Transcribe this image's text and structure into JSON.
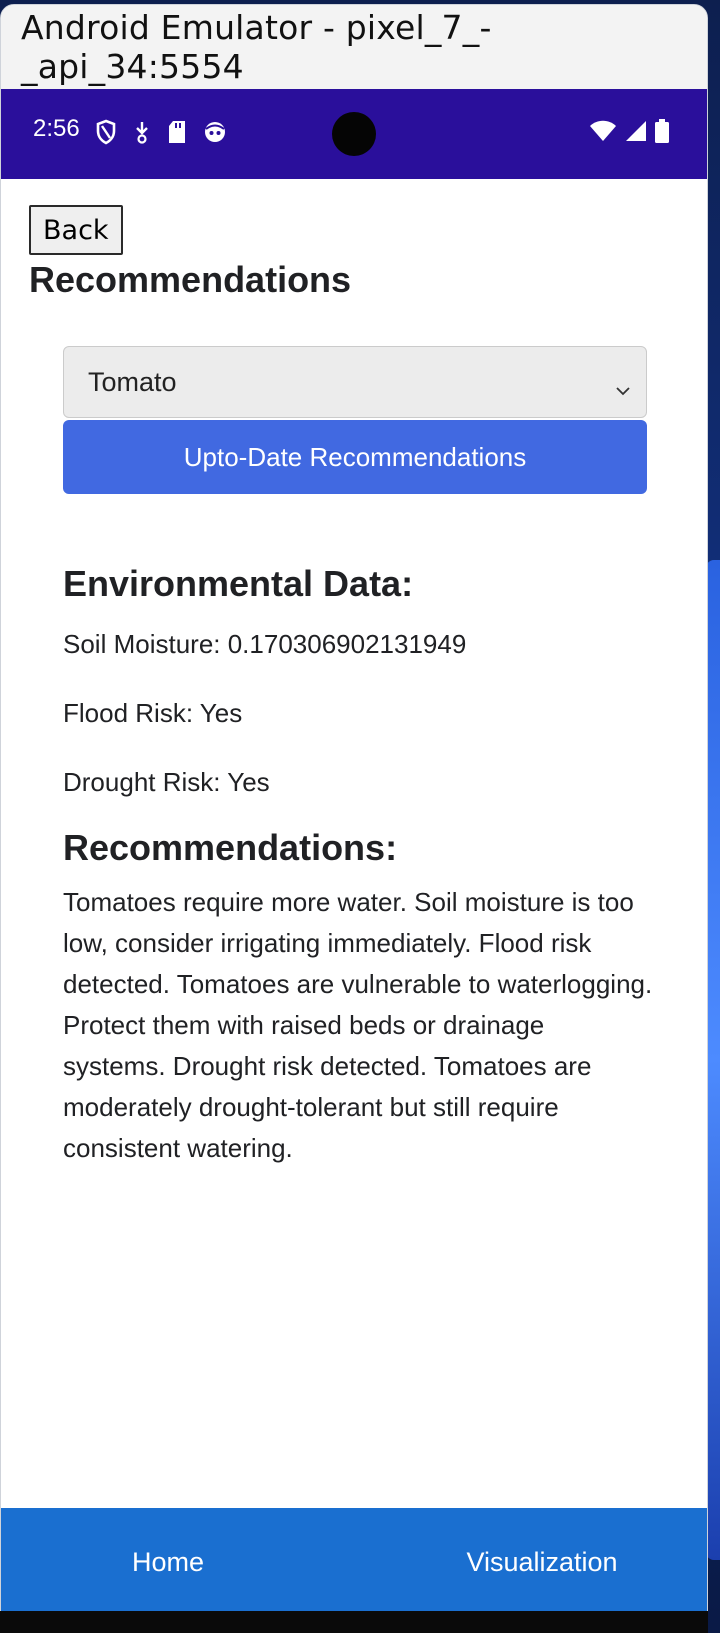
{
  "window": {
    "title": "Android Emulator - pixel_7_-_api_34:5554"
  },
  "status_bar": {
    "time": "2:56",
    "left_icons": [
      "shield-icon",
      "download-icon",
      "sd-card-icon",
      "face-icon"
    ],
    "right_icons": [
      "wifi-icon",
      "signal-icon",
      "battery-icon"
    ]
  },
  "page": {
    "back_label": "Back",
    "title": "Recommendations",
    "crop_select": {
      "value": "Tomato"
    },
    "update_button_label": "Upto-Date Recommendations"
  },
  "environment": {
    "heading": "Environmental Data:",
    "soil_moisture": "Soil Moisture: 0.170306902131949",
    "flood_risk": "Flood Risk: Yes",
    "drought_risk": "Drought Risk: Yes"
  },
  "recommendations": {
    "heading": "Recommendations:",
    "text": "Tomatoes require more water. Soil moisture is too low, consider irrigating immediately. Flood risk detected. Tomatoes are vulnerable to waterlogging. Protect them with raised beds or drainage systems. Drought risk detected. Tomatoes are moderately drought-tolerant but still require consistent watering."
  },
  "bottom_nav": {
    "items": [
      {
        "label": "Home"
      },
      {
        "label": "Visualization"
      }
    ]
  },
  "colors": {
    "status_bar": "#2a0f9b",
    "primary_button": "#4169e1",
    "bottom_nav": "#1a6fd0"
  }
}
